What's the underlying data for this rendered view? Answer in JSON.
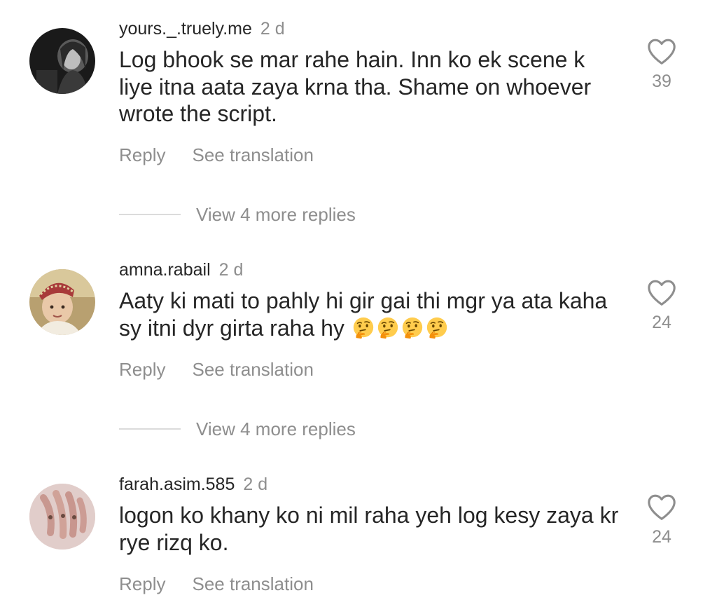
{
  "comments": [
    {
      "username": "yours._.truely.me",
      "time": "2 d",
      "text": "Log bhook se mar rahe hain. Inn ko ek scene k liye itna aata zaya krna tha. Shame on whoever wrote the script.",
      "likes": "39",
      "reply_label": "Reply",
      "translate_label": "See translation",
      "view_replies_label": "View 4 more replies"
    },
    {
      "username": "amna.rabail",
      "time": "2 d",
      "text": "Aaty ki mati to pahly hi gir gai thi mgr ya ata kaha sy itni dyr girta raha hy",
      "emoji": "🤔🤔🤔🤔",
      "likes": "24",
      "reply_label": "Reply",
      "translate_label": "See translation",
      "view_replies_label": "View 4 more replies"
    },
    {
      "username": "farah.asim.585",
      "time": "2 d",
      "text": "logon ko khany ko ni mil raha yeh log kesy zaya kr rye rizq ko.",
      "likes": "24",
      "reply_label": "Reply",
      "translate_label": "See translation"
    }
  ],
  "icons": {
    "like": "heart-outline-icon",
    "reaction": "thinking-face-emoji"
  },
  "colors": {
    "text": "#262626",
    "secondary": "#8e8e8e",
    "divider": "#dbdbdb",
    "background": "#ffffff"
  }
}
